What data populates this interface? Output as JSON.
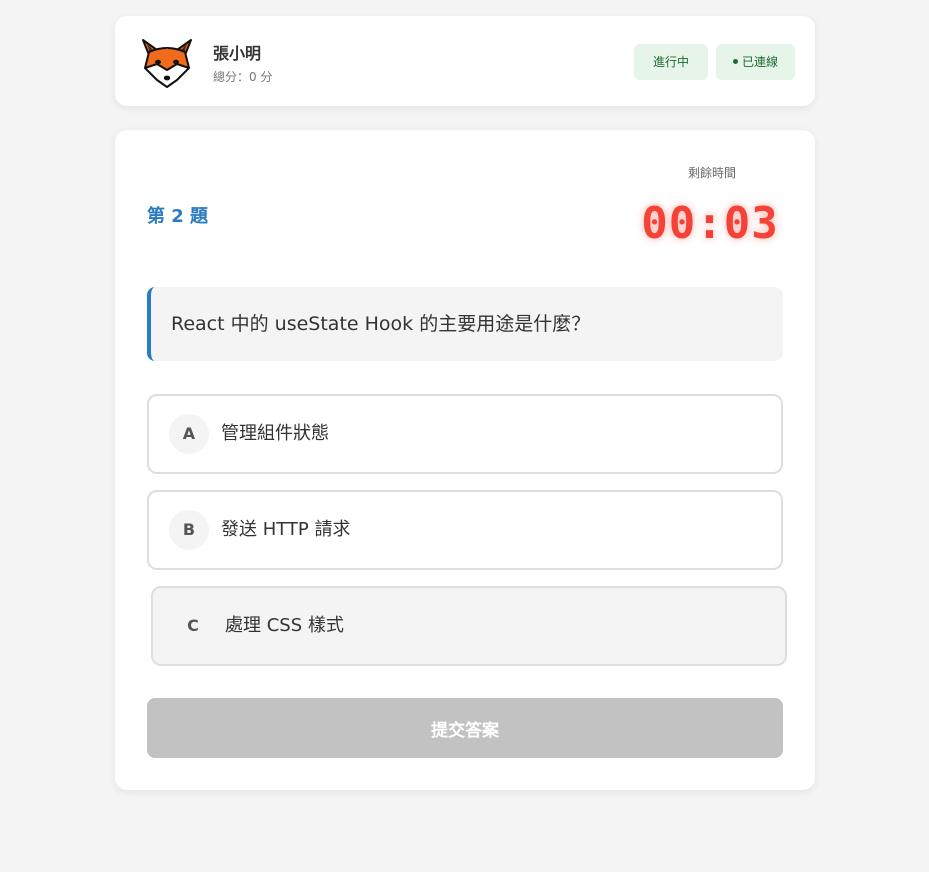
{
  "player": {
    "name": "張小明",
    "score_text": "總分：0 分",
    "avatar_icon": "fox-icon"
  },
  "status": {
    "game_state": "進行中",
    "connection": "已連線",
    "badge_bg": "#e6f4ea",
    "badge_color": "#1e6b2f"
  },
  "quiz": {
    "question_number": "第 2 題",
    "timer_label": "剩餘時間",
    "timer_value": "00:03",
    "timer_color": "#f44336",
    "accent_color": "#2b7bc3",
    "question": "React 中的 useState Hook 的主要用途是什麼？",
    "options": [
      {
        "letter": "A",
        "text": "管理組件狀態"
      },
      {
        "letter": "B",
        "text": "發送 HTTP 請求"
      },
      {
        "letter": "C",
        "text": "處理 CSS 樣式"
      }
    ],
    "submit_label": "提交答案",
    "submit_enabled": false
  }
}
